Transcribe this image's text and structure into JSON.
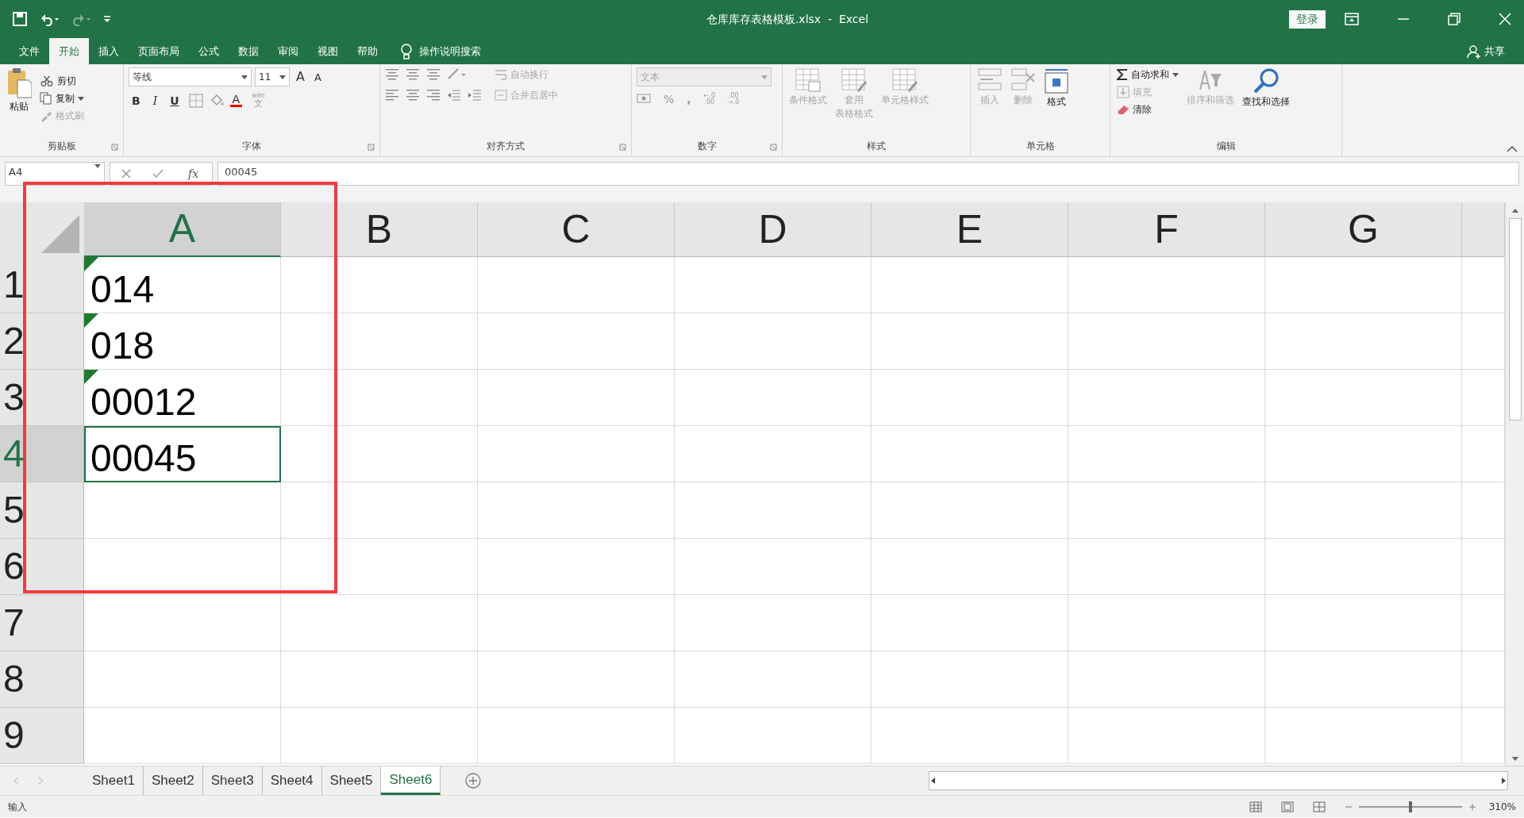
{
  "title": "仓库库存表格模板.xlsx  -  Excel",
  "sign_in": "登录",
  "tabs": [
    {
      "label": "文件",
      "selected": false
    },
    {
      "label": "开始",
      "selected": true
    },
    {
      "label": "插入",
      "selected": false
    },
    {
      "label": "页面布局",
      "selected": false
    },
    {
      "label": "公式",
      "selected": false
    },
    {
      "label": "数据",
      "selected": false
    },
    {
      "label": "审阅",
      "selected": false
    },
    {
      "label": "视图",
      "selected": false
    },
    {
      "label": "帮助",
      "selected": false
    }
  ],
  "tell_me": "操作说明搜索",
  "share": "共享",
  "ribbon": {
    "clipboard": {
      "label": "剪贴板",
      "paste": {
        "label": "粘贴",
        "disabled": false
      },
      "cut": {
        "label": "剪切",
        "disabled": false
      },
      "copy": {
        "label": "复制",
        "disabled": false
      },
      "format_painter": {
        "label": "格式刷",
        "disabled": true
      }
    },
    "font": {
      "label": "字体",
      "font_name": "等线",
      "font_size": "11",
      "grow": "A",
      "shrink": "A",
      "bold": "B",
      "italic": "I",
      "underline": "U",
      "font_color": "A",
      "phonetic_top": "wén",
      "phonetic": "文"
    },
    "alignment": {
      "label": "对齐方式",
      "wrap_text": {
        "label": "自动换行",
        "disabled": true
      },
      "merge_center": {
        "label": "合并后居中",
        "disabled": true
      }
    },
    "number": {
      "label": "数字",
      "format": {
        "value": "文本",
        "disabled": true
      },
      "percent": "%",
      "comma": ",",
      "increase_decimal": [
        "←.0",
        ".00"
      ],
      "decrease_decimal": [
        ".00",
        "→.0"
      ]
    },
    "styles": {
      "label": "样式",
      "commands": [
        {
          "lines": [
            "条件格式"
          ],
          "disabled": true
        },
        {
          "lines": [
            "套用",
            "表格格式"
          ],
          "disabled": true
        },
        {
          "lines": [
            "单元格样式"
          ],
          "disabled": true
        }
      ]
    },
    "cells": {
      "label": "单元格",
      "commands": [
        {
          "lines": [
            "插入"
          ],
          "disabled": true
        },
        {
          "lines": [
            "删除"
          ],
          "disabled": true
        },
        {
          "lines": [
            "格式"
          ],
          "disabled": false
        }
      ]
    },
    "editing": {
      "label": "编辑",
      "autosum": {
        "label": "自动求和",
        "disabled": false
      },
      "fill": {
        "label": "填充",
        "disabled": true
      },
      "clear": {
        "label": "清除",
        "disabled": false
      },
      "sort_filter": {
        "label": "排序和筛选",
        "disabled": true
      },
      "find_select": {
        "label": "查找和选择",
        "disabled": false
      }
    }
  },
  "formula_bar": {
    "name_box": "A4",
    "function_label": "fx",
    "formula": "00045"
  },
  "columns": [
    {
      "label": "A",
      "selected": true
    },
    {
      "label": "B",
      "selected": false
    },
    {
      "label": "C",
      "selected": false
    },
    {
      "label": "D",
      "selected": false
    },
    {
      "label": "E",
      "selected": false
    },
    {
      "label": "F",
      "selected": false
    },
    {
      "label": "G",
      "selected": false
    }
  ],
  "rows": [
    {
      "label": "1",
      "selected": false,
      "cells": [
        {
          "value": "014",
          "error_flag": true,
          "selected": false
        }
      ]
    },
    {
      "label": "2",
      "selected": false,
      "cells": [
        {
          "value": "018",
          "error_flag": true,
          "selected": false
        }
      ]
    },
    {
      "label": "3",
      "selected": false,
      "cells": [
        {
          "value": "00012",
          "error_flag": true,
          "selected": false
        }
      ]
    },
    {
      "label": "4",
      "selected": true,
      "cells": [
        {
          "value": "00045",
          "error_flag": false,
          "selected": true
        }
      ]
    },
    {
      "label": "5",
      "selected": false
    },
    {
      "label": "6",
      "selected": false
    },
    {
      "label": "7",
      "selected": false
    },
    {
      "label": "8",
      "selected": false
    },
    {
      "label": "9",
      "selected": false
    }
  ],
  "sheet_tabs": [
    {
      "label": "Sheet1",
      "selected": false
    },
    {
      "label": "Sheet2",
      "selected": false
    },
    {
      "label": "Sheet3",
      "selected": false
    },
    {
      "label": "Sheet4",
      "selected": false
    },
    {
      "label": "Sheet5",
      "selected": false
    },
    {
      "label": "Sheet6",
      "selected": true
    }
  ],
  "status_bar": {
    "mode": "输入",
    "zoom": "310%",
    "zoom_slider": {
      "level": 0.5
    }
  },
  "annotations": [
    {
      "kind": "frame"
    }
  ]
}
